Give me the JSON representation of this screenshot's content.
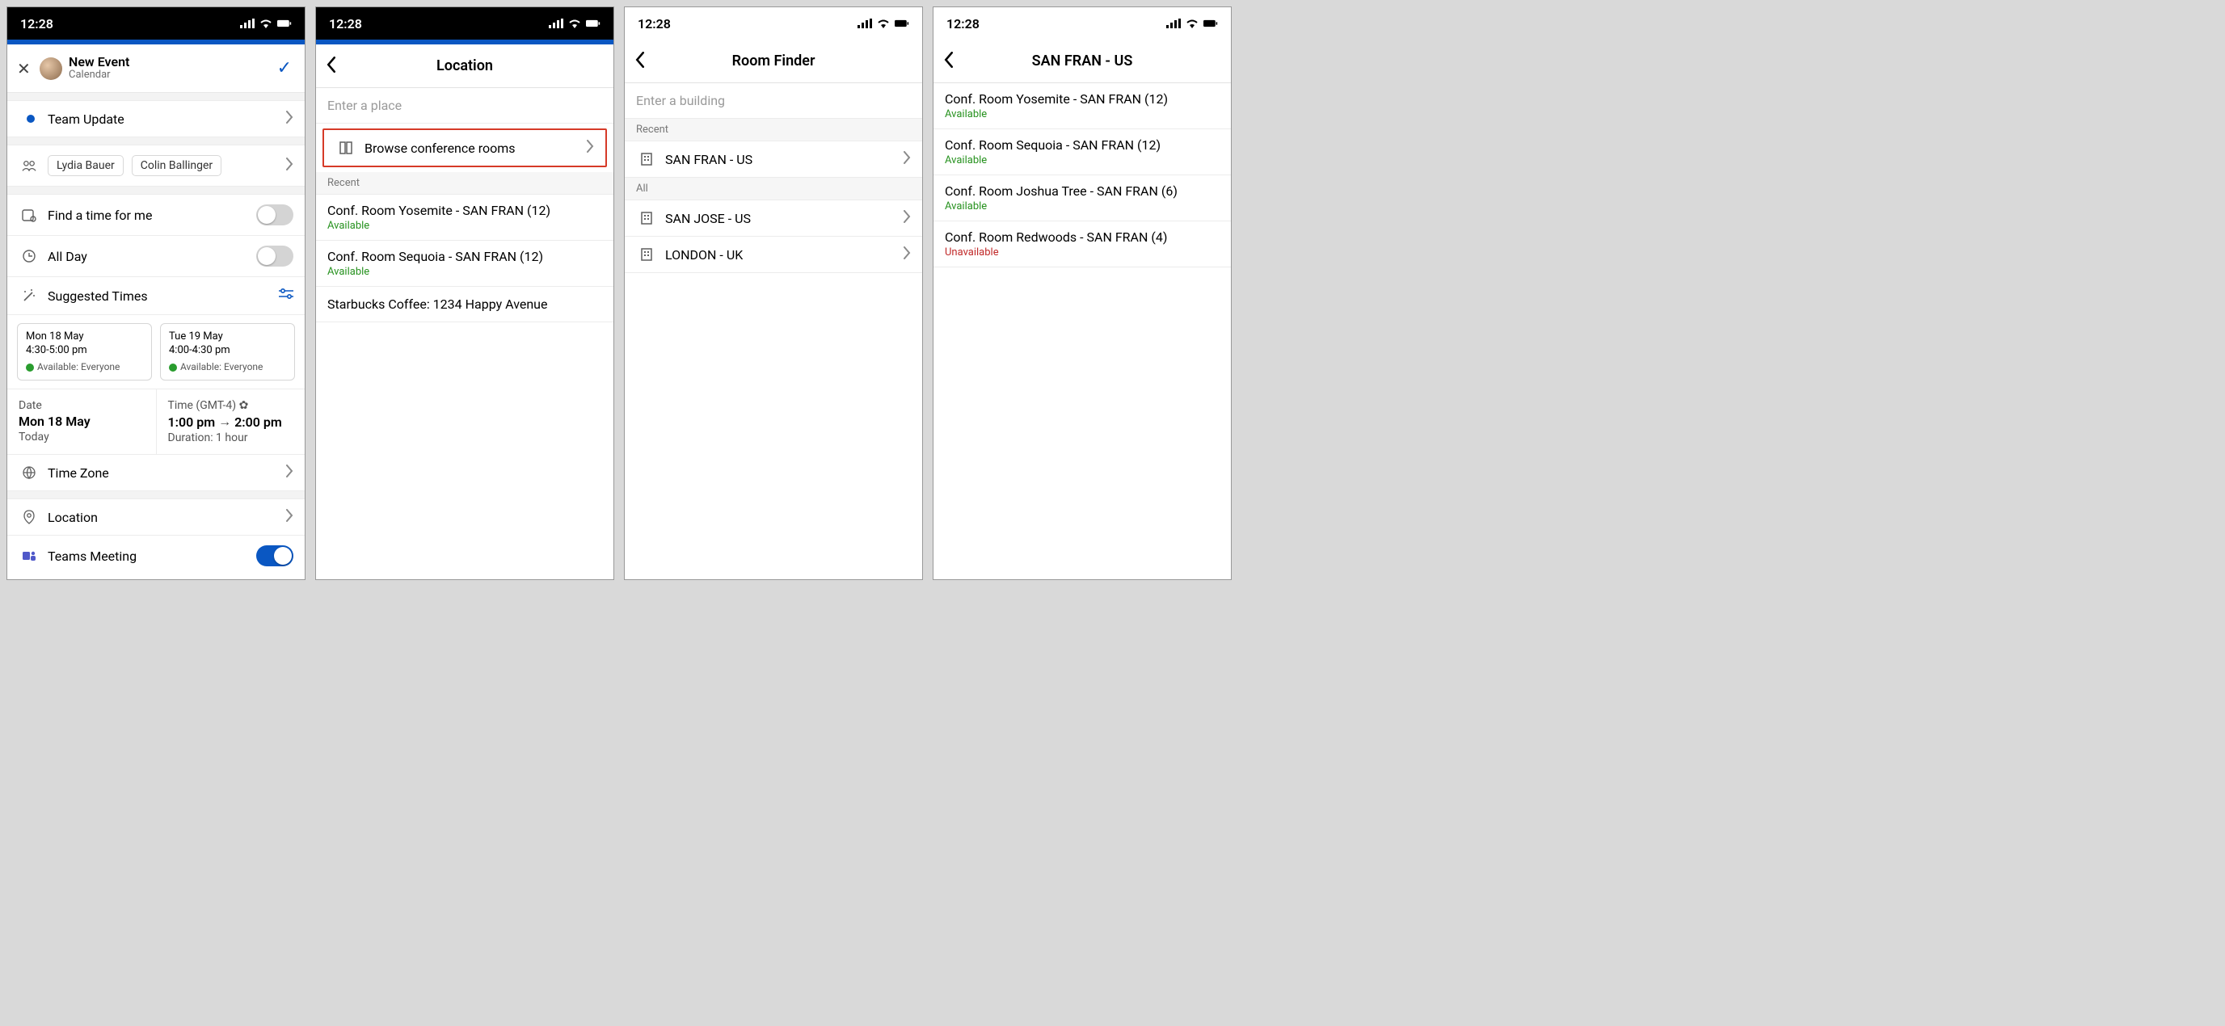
{
  "status": {
    "time": "12:28"
  },
  "screen1": {
    "header": {
      "title": "New Event",
      "subtitle": "Calendar"
    },
    "eventTitle": "Team Update",
    "attendees": [
      "Lydia Bauer",
      "Colin Ballinger"
    ],
    "findTime": "Find a time for me",
    "allDay": "All Day",
    "suggested": "Suggested Times",
    "cards": [
      {
        "day": "Mon 18 May",
        "range": "4:30-5:00 pm",
        "avail": "Available: Everyone"
      },
      {
        "day": "Tue 19 May",
        "range": "4:00-4:30 pm",
        "avail": "Available: Everyone"
      }
    ],
    "dateLabel": "Date",
    "dateValue": "Mon 18 May",
    "dateSub": "Today",
    "timeLabel": "Time (GMT-4)",
    "timeStart": "1:00 pm",
    "timeEnd": "2:00 pm",
    "timeSub": "Duration: 1 hour",
    "timeZone": "Time Zone",
    "location": "Location",
    "teams": "Teams Meeting"
  },
  "screen2": {
    "title": "Location",
    "placeholder": "Enter a place",
    "browse": "Browse conference rooms",
    "recentLabel": "Recent",
    "recent": [
      {
        "name": "Conf. Room Yosemite - SAN FRAN (12)",
        "status": "Available",
        "available": true
      },
      {
        "name": "Conf. Room Sequoia - SAN FRAN (12)",
        "status": "Available",
        "available": true
      }
    ],
    "other": "Starbucks Coffee: 1234 Happy Avenue"
  },
  "screen3": {
    "title": "Room Finder",
    "placeholder": "Enter a building",
    "recentLabel": "Recent",
    "recent": [
      "SAN FRAN - US"
    ],
    "allLabel": "All",
    "all": [
      "SAN JOSE - US",
      "LONDON - UK"
    ]
  },
  "screen4": {
    "title": "SAN FRAN - US",
    "rooms": [
      {
        "name": "Conf. Room Yosemite - SAN FRAN (12)",
        "status": "Available",
        "available": true
      },
      {
        "name": "Conf. Room Sequoia - SAN FRAN (12)",
        "status": "Available",
        "available": true
      },
      {
        "name": "Conf. Room Joshua Tree - SAN FRAN (6)",
        "status": "Available",
        "available": true
      },
      {
        "name": "Conf. Room Redwoods - SAN FRAN (4)",
        "status": "Unavailable",
        "available": false
      }
    ]
  }
}
